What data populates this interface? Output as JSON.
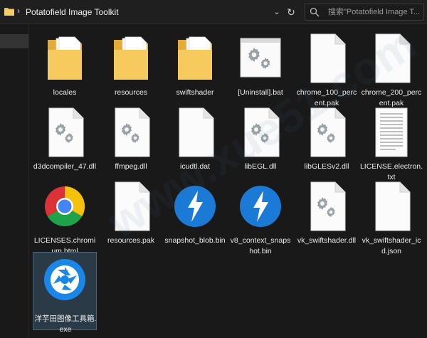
{
  "address_bar": {
    "path": "Potatofield Image Toolkit",
    "search_placeholder": "搜索\"Potatofield Image T..."
  },
  "watermark": "www.xue51.com",
  "files": [
    {
      "name": "locales",
      "icon": "folder-icon"
    },
    {
      "name": "resources",
      "icon": "folder-icon"
    },
    {
      "name": "swiftshader",
      "icon": "folder-icon"
    },
    {
      "name": "[Uninstall].bat",
      "icon": "batch-file-icon"
    },
    {
      "name": "chrome_100_percent.pak",
      "icon": "blank-file-icon"
    },
    {
      "name": "chrome_200_percent.pak",
      "icon": "blank-file-icon"
    },
    {
      "name": "d3dcompiler_47.dll",
      "icon": "dll-file-icon"
    },
    {
      "name": "ffmpeg.dll",
      "icon": "dll-file-icon"
    },
    {
      "name": "icudtl.dat",
      "icon": "blank-file-icon"
    },
    {
      "name": "libEGL.dll",
      "icon": "dll-file-icon"
    },
    {
      "name": "libGLESv2.dll",
      "icon": "dll-file-icon"
    },
    {
      "name": "LICENSE.electron.txt",
      "icon": "text-file-icon"
    },
    {
      "name": "LICENSES.chromium.html",
      "icon": "chrome-html-icon"
    },
    {
      "name": "resources.pak",
      "icon": "blank-file-icon"
    },
    {
      "name": "snapshot_blob.bin",
      "icon": "bin-file-icon"
    },
    {
      "name": "v8_context_snapshot.bin",
      "icon": "bin-file-icon"
    },
    {
      "name": "vk_swiftshader.dll",
      "icon": "dll-file-icon"
    },
    {
      "name": "vk_swiftshader_icd.json",
      "icon": "blank-file-icon"
    },
    {
      "name": "洋芋田图像工具箱.exe",
      "icon": "app-camera-icon"
    }
  ]
}
